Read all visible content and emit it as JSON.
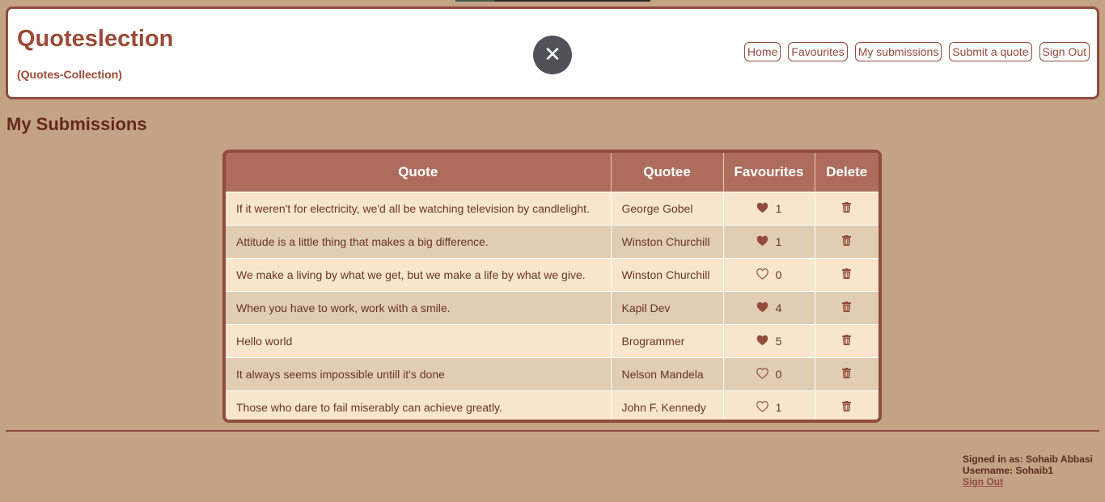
{
  "brand": {
    "title": "Quoteslection",
    "subtitle": "(Quotes-Collection)"
  },
  "overlay": {
    "close_glyph": "✕"
  },
  "nav": [
    {
      "label": "Home"
    },
    {
      "label": "Favourites"
    },
    {
      "label": "My submissions"
    },
    {
      "label": "Submit a quote"
    },
    {
      "label": "Sign Out"
    }
  ],
  "page": {
    "title": "My Submissions"
  },
  "table": {
    "headers": [
      "Quote",
      "Quotee",
      "Favourites",
      "Delete"
    ],
    "rows": [
      {
        "quote": "If it weren't for electricity, we'd all be watching television by candlelight.",
        "quotee": "George Gobel",
        "favourited": true,
        "count": "1"
      },
      {
        "quote": "Attitude is a little thing that makes a big difference.",
        "quotee": "Winston Churchill",
        "favourited": true,
        "count": "1"
      },
      {
        "quote": "We make a living by what we get, but we make a life by what we give.",
        "quotee": "Winston Churchill",
        "favourited": false,
        "count": "0"
      },
      {
        "quote": "When you have to work, work with a smile.",
        "quotee": "Kapil Dev",
        "favourited": true,
        "count": "4"
      },
      {
        "quote": "Hello world",
        "quotee": "Brogrammer",
        "favourited": true,
        "count": "5"
      },
      {
        "quote": "It always seems impossible untill it's done",
        "quotee": "Nelson Mandela",
        "favourited": false,
        "count": "0"
      },
      {
        "quote": "Those who dare to fail miserably can achieve greatly.",
        "quotee": "John F. Kennedy",
        "favourited": false,
        "count": "1"
      }
    ]
  },
  "footer": {
    "signed_in_as": "Signed in as: Sohaib Abbasi",
    "username": "Username: Sohaib1",
    "sign_out": "Sign Out"
  },
  "colors": {
    "background": "#c4a385",
    "accent": "#924b3c",
    "header_row": "#ad6c5c",
    "row_light": "#f7e6cb",
    "row_dark": "#e0cdb2",
    "close_button": "#4f5256"
  },
  "icons": {
    "favourite": "heart-icon",
    "delete": "trash-icon",
    "close": "close-icon"
  }
}
